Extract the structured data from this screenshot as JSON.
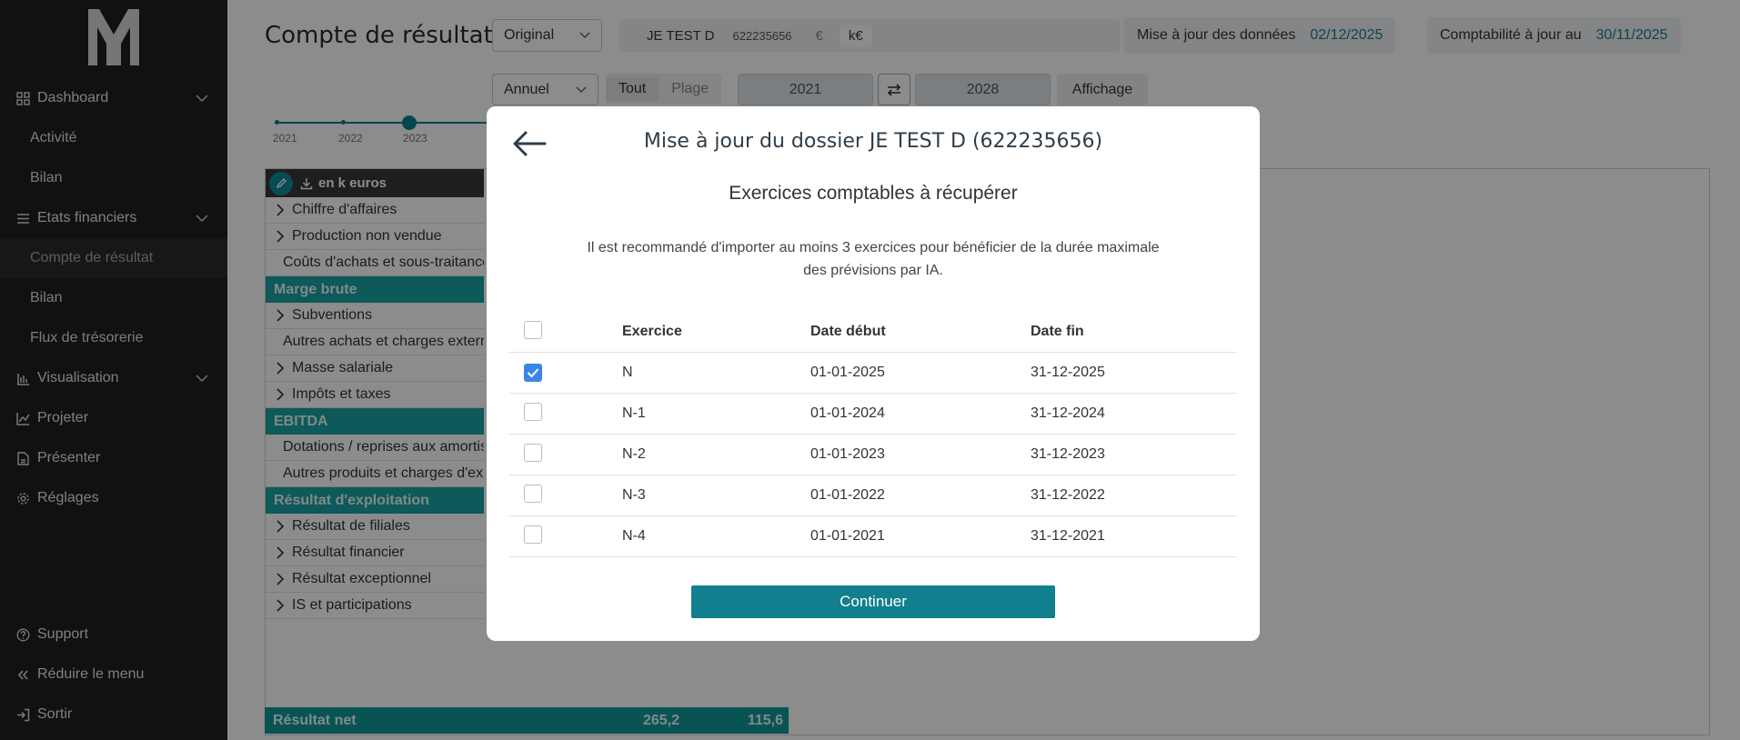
{
  "sidebar": {
    "items": [
      {
        "label": "Dashboard",
        "icon": "grid-icon",
        "expandable": true
      },
      {
        "label": "Activité",
        "sub": true
      },
      {
        "label": "Bilan",
        "sub": true
      },
      {
        "label": "Etats financiers",
        "icon": "menu-icon",
        "expandable": true
      },
      {
        "label": "Compte de résultat",
        "sub": true,
        "active": true
      },
      {
        "label": "Bilan",
        "sub": true
      },
      {
        "label": "Flux de trésorerie",
        "sub": true
      },
      {
        "label": "Visualisation",
        "icon": "bar-chart-icon",
        "expandable": true
      },
      {
        "label": "Projeter",
        "icon": "trend-icon"
      },
      {
        "label": "Présenter",
        "icon": "present-icon"
      },
      {
        "label": "Réglages",
        "icon": "gear-icon"
      }
    ],
    "bottom": [
      {
        "label": "Support",
        "icon": "help-icon"
      },
      {
        "label": "Réduire le menu",
        "icon": "collapse-icon"
      },
      {
        "label": "Sortir",
        "icon": "logout-icon"
      }
    ]
  },
  "header": {
    "title": "Compte de résultat",
    "version_select": "Original",
    "company_name": "JE TEST D",
    "company_siren": "622235656",
    "currency": "€",
    "currency_unit": "k€",
    "data_update_label": "Mise à jour des données",
    "data_update_date": "02/12/2025",
    "accounting_label": "Comptabilité à jour au",
    "accounting_date": "30/11/2025"
  },
  "toolbar": {
    "period_select": "Annuel",
    "seg_all": "Tout",
    "seg_range": "Plage",
    "year_from": "2021",
    "year_to": "2028",
    "display_button": "Affichage"
  },
  "timeline": {
    "years": [
      "2021",
      "2022",
      "2023"
    ],
    "selected": "2023"
  },
  "table": {
    "header_label": "en k euros",
    "rows": [
      {
        "label": "Chiffre d'affaires",
        "type": "line"
      },
      {
        "label": "Production non vendue",
        "type": "line"
      },
      {
        "label": "Coûts d'achats et sous-traitance",
        "type": "line"
      },
      {
        "label": "Marge brute",
        "type": "total"
      },
      {
        "label": "Subventions",
        "type": "line"
      },
      {
        "label": "Autres achats et charges externes",
        "type": "line"
      },
      {
        "label": "Masse salariale",
        "type": "line"
      },
      {
        "label": "Impôts et taxes",
        "type": "line"
      },
      {
        "label": "EBITDA",
        "type": "total"
      },
      {
        "label": "Dotations / reprises aux amortissements",
        "type": "line"
      },
      {
        "label": "Autres produits et charges d'exploitation",
        "type": "line"
      },
      {
        "label": "Résultat d'exploitation",
        "type": "total"
      },
      {
        "label": "Résultat de filiales",
        "type": "line"
      },
      {
        "label": "Résultat financier",
        "type": "line"
      },
      {
        "label": "Résultat exceptionnel",
        "type": "line"
      },
      {
        "label": "IS et participations",
        "type": "line"
      }
    ],
    "net_result": {
      "label": "Résultat net",
      "value1": "265,2",
      "value2": "115,6"
    }
  },
  "modal": {
    "title": "Mise à jour du dossier JE TEST D (622235656)",
    "subtitle": "Exercices comptables à récupérer",
    "description": "Il est recommandé d'importer au moins 3 exercices pour bénéficier de la durée maximale des prévisions par IA.",
    "columns": [
      "Exercice",
      "Date début",
      "Date fin"
    ],
    "rows": [
      {
        "exercice": "N",
        "debut": "01-01-2025",
        "fin": "31-12-2025",
        "checked": true
      },
      {
        "exercice": "N-1",
        "debut": "01-01-2024",
        "fin": "31-12-2024",
        "checked": false
      },
      {
        "exercice": "N-2",
        "debut": "01-01-2023",
        "fin": "31-12-2023",
        "checked": false
      },
      {
        "exercice": "N-3",
        "debut": "01-01-2022",
        "fin": "31-12-2022",
        "checked": false
      },
      {
        "exercice": "N-4",
        "debut": "01-01-2021",
        "fin": "31-12-2021",
        "checked": false
      }
    ],
    "continue_label": "Continuer"
  },
  "colors": {
    "accent": "#117f8e",
    "teal_row": "#1aa3a3",
    "sidebar_bg": "#1f2023",
    "checkbox_on": "#3a86e6"
  }
}
